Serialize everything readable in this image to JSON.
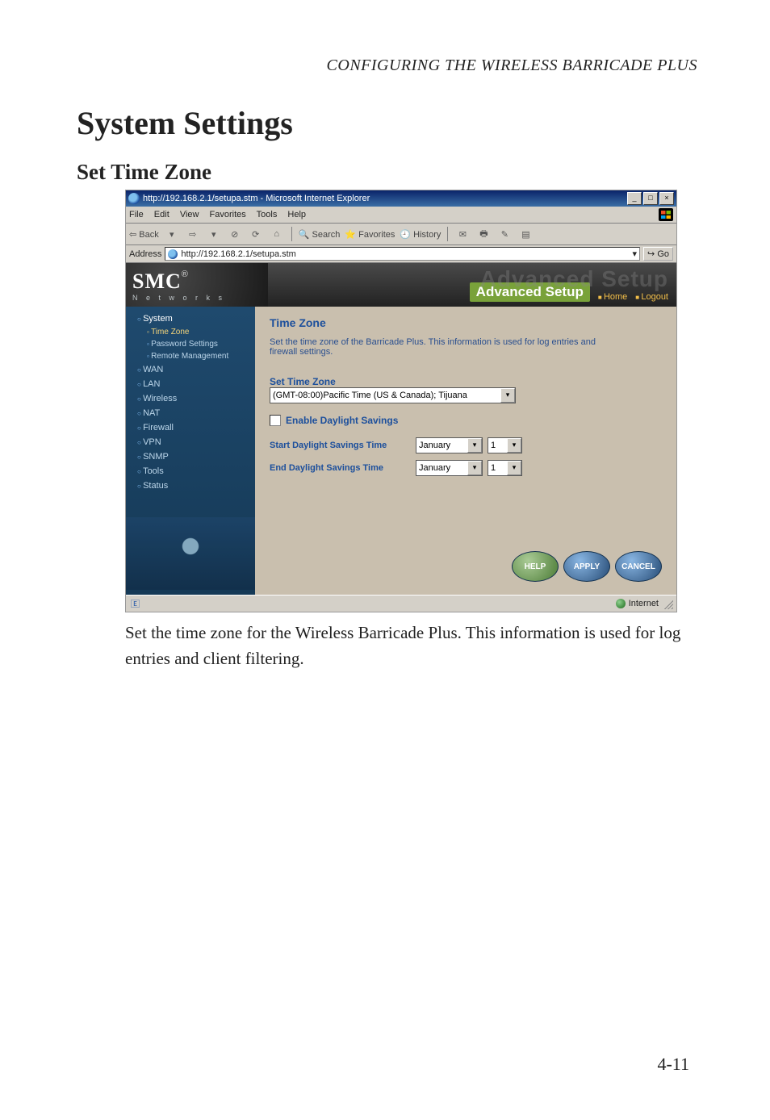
{
  "running_head": "CONFIGURING THE WIRELESS BARRICADE PLUS",
  "section_title": "System Settings",
  "sub_title": "Set Time Zone",
  "browser": {
    "title": "http://192.168.2.1/setupa.stm - Microsoft Internet Explorer",
    "menu": {
      "file": "File",
      "edit": "Edit",
      "view": "View",
      "favorites": "Favorites",
      "tools": "Tools",
      "help": "Help"
    },
    "toolbar": {
      "back": "Back",
      "search": "Search",
      "favorites": "Favorites",
      "history": "History"
    },
    "address_label": "Address",
    "url": "http://192.168.2.1/setupa.stm",
    "go": "Go",
    "status_done_icon": "e",
    "status_zone": "Internet"
  },
  "brand": {
    "logo": "SMC",
    "reg": "®",
    "sub": "N e t w o r k s",
    "ghost": "Advanced Setup",
    "pill": "Advanced Setup",
    "home": "Home",
    "logout": "Logout"
  },
  "sidebar": {
    "system": "System",
    "time_zone": "Time Zone",
    "password_settings": "Password Settings",
    "remote_management": "Remote Management",
    "wan": "WAN",
    "lan": "LAN",
    "wireless": "Wireless",
    "nat": "NAT",
    "firewall": "Firewall",
    "vpn": "VPN",
    "snmp": "SNMP",
    "tools": "Tools",
    "status": "Status"
  },
  "main": {
    "heading": "Time Zone",
    "desc": "Set the time zone of the Barricade Plus.  This information is used for log entries and firewall settings.",
    "set_label": "Set Time Zone",
    "tz_value": "(GMT-08:00)Pacific Time (US & Canada); Tijuana",
    "enable_daylight": "Enable Daylight Savings",
    "start_label": "Start Daylight Savings Time",
    "end_label": "End Daylight Savings Time",
    "month": "January",
    "day": "1",
    "help": "HELP",
    "apply": "APPLY",
    "cancel": "CANCEL"
  },
  "body_text": "Set the time zone for the Wireless Barricade Plus. This information is used for log entries and client filtering.",
  "page_number": "4-11"
}
